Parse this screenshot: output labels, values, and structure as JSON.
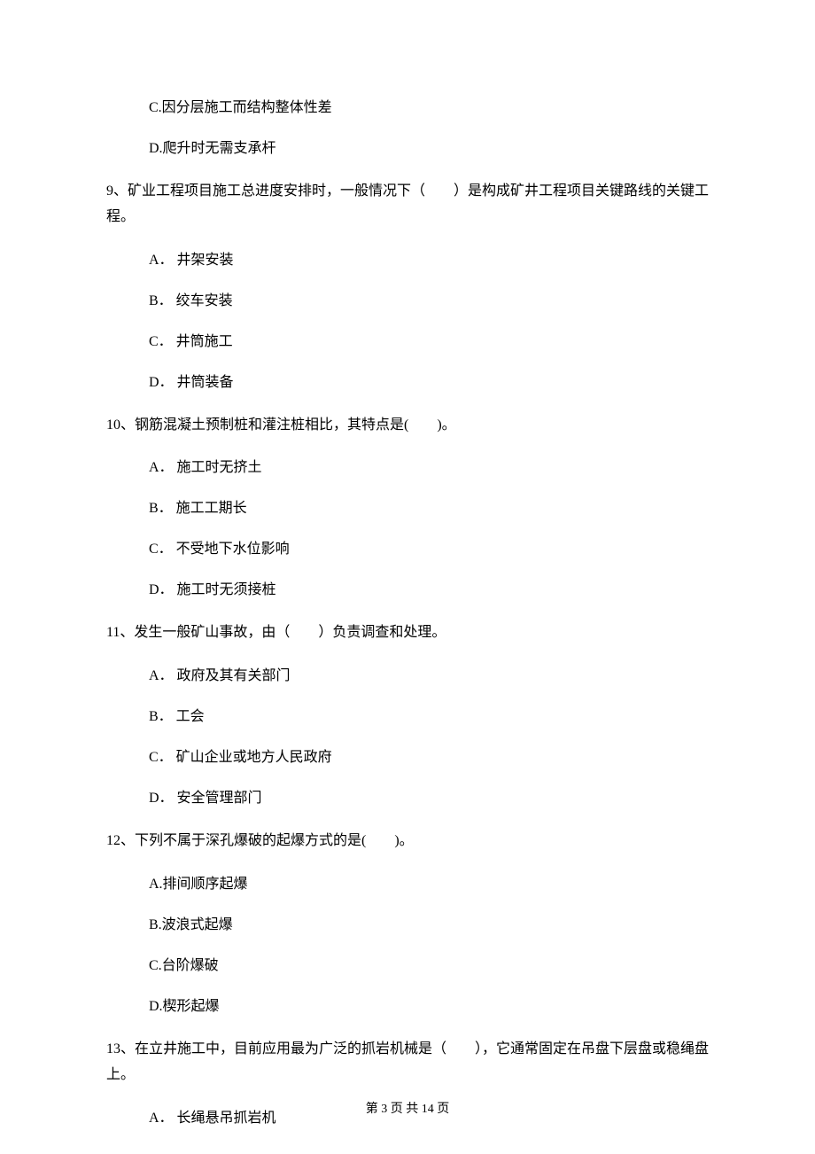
{
  "partial": {
    "optC": "C.因分层施工而结构整体性差",
    "optD": "D.爬升时无需支承杆"
  },
  "q9": {
    "text": "9、矿业工程项目施工总进度安排时，一般情况下（　　）是构成矿井工程项目关键路线的关键工程。",
    "A": "A． 井架安装",
    "B": "B． 绞车安装",
    "C": "C． 井筒施工",
    "D": "D． 井筒装备"
  },
  "q10": {
    "text": "10、钢筋混凝土预制桩和灌注桩相比，其特点是(　　)。",
    "A": "A． 施工时无挤土",
    "B": "B． 施工工期长",
    "C": "C． 不受地下水位影响",
    "D": "D． 施工时无须接桩"
  },
  "q11": {
    "text": "11、发生一般矿山事故，由（　　）负责调查和处理。",
    "A": "A． 政府及其有关部门",
    "B": "B． 工会",
    "C": "C． 矿山企业或地方人民政府",
    "D": "D． 安全管理部门"
  },
  "q12": {
    "text": "12、下列不属于深孔爆破的起爆方式的是(　　)。",
    "A": "A.排间顺序起爆",
    "B": "B.波浪式起爆",
    "C": "C.台阶爆破",
    "D": "D.楔形起爆"
  },
  "q13": {
    "text": "13、在立井施工中，目前应用最为广泛的抓岩机械是（　　），它通常固定在吊盘下层盘或稳绳盘上。",
    "A": "A． 长绳悬吊抓岩机"
  },
  "footer": "第 3 页 共 14 页"
}
